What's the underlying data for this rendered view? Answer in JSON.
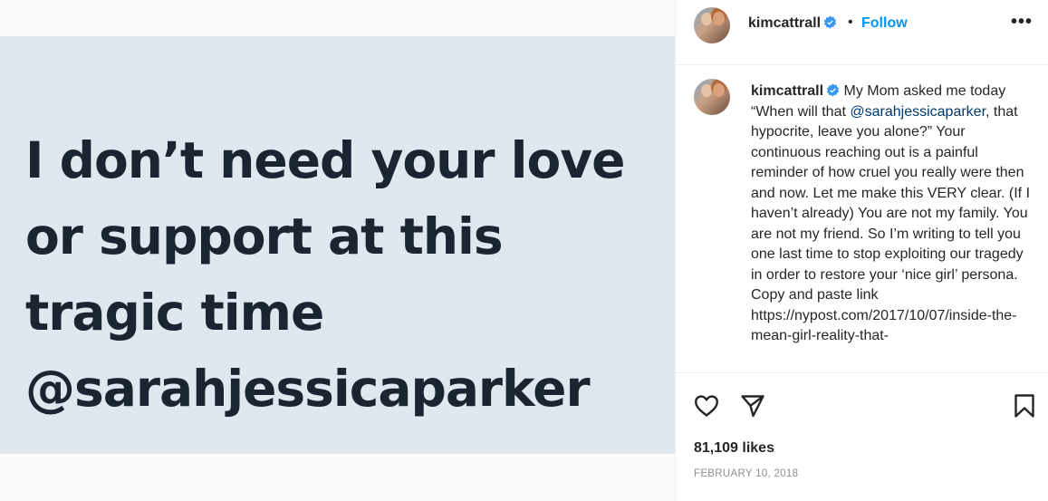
{
  "media": {
    "lines": [
      "I don’t need your love",
      "or support at this",
      "tragic time",
      "@sarahjessicaparker"
    ]
  },
  "header": {
    "username": "kimcattrall",
    "separator": "•",
    "follow_label": "Follow",
    "more_label": "•••"
  },
  "caption": {
    "username": "kimcattrall",
    "text_1": "My Mom asked me today “When will that ",
    "mention": "@sarahjessicaparker",
    "text_2": ", that hypocrite, leave you alone?” Your continuous reaching out is a painful reminder of how cruel you really were then and now. Let me make this VERY clear. (If I haven’t already) You are not my family. You are not my friend. So I’m writing to tell you one last time to stop exploiting our tragedy in order to restore your ‘nice girl’ persona. Copy and paste link https://nypost.com/2017/10/07/inside-the-mean-girl-reality-that-"
  },
  "stats": {
    "likes": "81,109 likes",
    "date": "FEBRUARY 10, 2018"
  },
  "colors": {
    "accent": "#0095f6",
    "verified": "#3897f0",
    "mention": "#00376b",
    "media_background": "#dfe7ef",
    "media_text": "#1b2431"
  },
  "icons": [
    "heart-icon",
    "share-icon",
    "bookmark-icon",
    "verified-badge-icon",
    "more-options-icon"
  ]
}
